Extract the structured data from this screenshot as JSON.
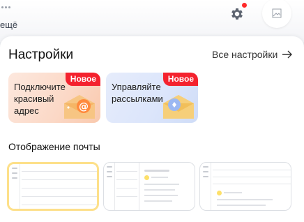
{
  "header": {
    "more_label": "ещё",
    "icons": [
      "settings-icon",
      "notification-dot",
      "avatar-placeholder-icon"
    ]
  },
  "settings": {
    "title": "Настройки",
    "all_settings_label": "Все настройки",
    "promo_cards": [
      {
        "text": "Подключите красивый адрес",
        "badge": "Новое",
        "icon": "at-sign-envelope"
      },
      {
        "text": "Управляйте рассылками",
        "badge": "Новое",
        "icon": "envelope-with-icon"
      }
    ],
    "mail_display_title": "Отображение почты",
    "layout_options": [
      "list-only",
      "two-pane-vertical",
      "two-pane-horizontal"
    ]
  },
  "colors": {
    "badge": "#f4222e",
    "notification_dot": "#ff2a2a",
    "selected_border": "#fde08a",
    "accent_yellow": "#fde06a"
  }
}
